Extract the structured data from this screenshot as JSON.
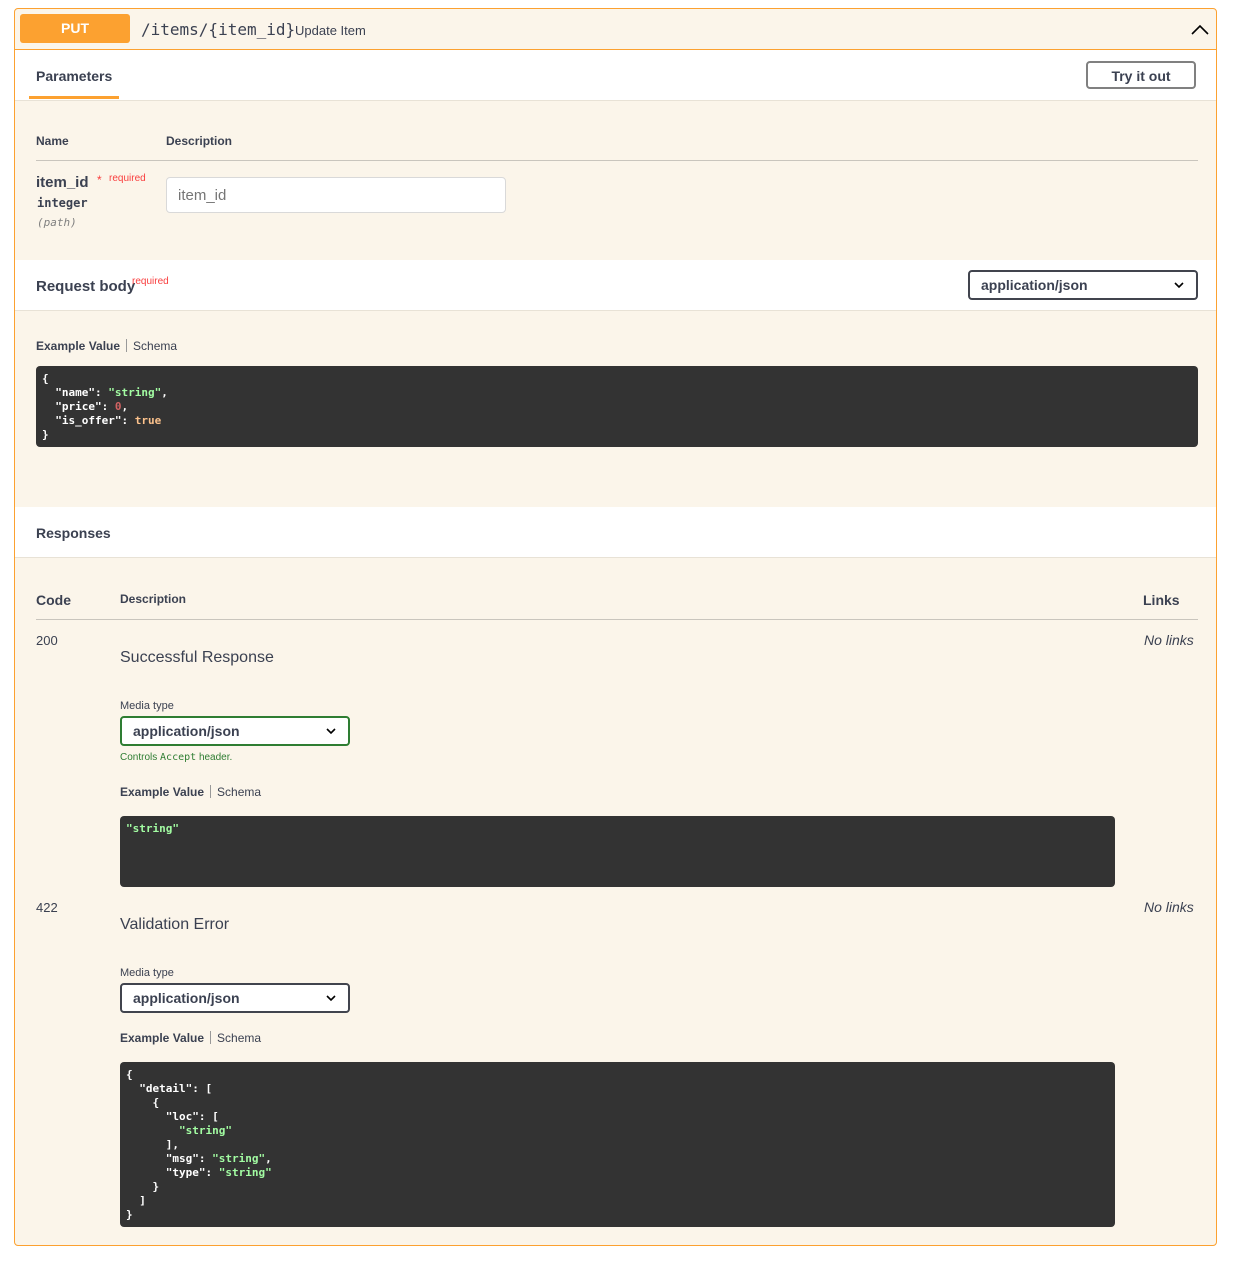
{
  "summary": {
    "method": "PUT",
    "path": "/items/{item_id}",
    "description": "Update Item"
  },
  "parameters": {
    "tab_label": "Parameters",
    "try_button": "Try it out",
    "header_name": "Name",
    "header_description": "Description",
    "items": [
      {
        "name": "item_id",
        "asterisk": "*",
        "required_label": "required",
        "type": "integer",
        "in": "(path)",
        "placeholder": "item_id"
      }
    ]
  },
  "request_body": {
    "title": "Request body",
    "required_label": "required",
    "content_type": "application/json",
    "tab_example": "Example Value",
    "tab_schema": "Schema"
  },
  "responses": {
    "title": "Responses",
    "header_code": "Code",
    "header_description": "Description",
    "header_links": "Links",
    "items": [
      {
        "code": "200",
        "description": "Successful Response",
        "media_type_label": "Media type",
        "media_type": "application/json",
        "controls_prefix": "Controls",
        "controls_code": "Accept",
        "controls_suffix": "header.",
        "tab_example": "Example Value",
        "tab_schema": "Schema",
        "links": "No links"
      },
      {
        "code": "422",
        "description": "Validation Error",
        "media_type_label": "Media type",
        "media_type": "application/json",
        "tab_example": "Example Value",
        "tab_schema": "Schema",
        "links": "No links"
      }
    ]
  },
  "colors": {
    "method_bg": "#fca130",
    "block_bg": "#fbf5ea",
    "code_bg": "#333333",
    "string": "#a2fca2",
    "number": "#d36363",
    "bool": "#fcc28c",
    "required": "#f93e3e"
  },
  "icons": {
    "collapse": "chevron-up-icon",
    "select_caret": "chevron-down-icon"
  }
}
